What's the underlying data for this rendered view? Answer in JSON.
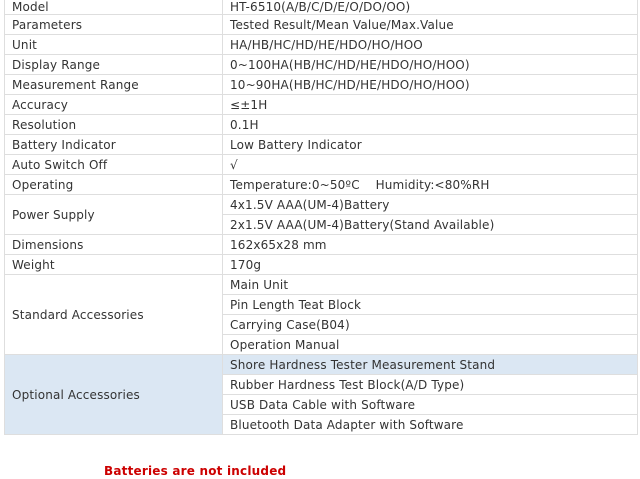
{
  "specs": {
    "model": {
      "label": "Model",
      "value": "HT-6510(A/B/C/D/E/O/DO/OO)"
    },
    "parameters": {
      "label": "Parameters",
      "value": "Tested Result/Mean Value/Max.Value"
    },
    "unit": {
      "label": "Unit",
      "value": "HA/HB/HC/HD/HE/HDO/HO/HOO"
    },
    "display_range": {
      "label": "Display Range",
      "value": "0~100HA(HB/HC/HD/HE/HDO/HO/HOO)"
    },
    "measurement_range": {
      "label": "Measurement Range",
      "value": "10~90HA(HB/HC/HD/HE/HDO/HO/HOO)"
    },
    "accuracy": {
      "label": "Accuracy",
      "value": "≤±1H"
    },
    "resolution": {
      "label": "Resolution",
      "value": "0.1H"
    },
    "battery_indicator": {
      "label": "Battery Indicator",
      "value": "Low Battery Indicator"
    },
    "auto_switch_off": {
      "label": "Auto Switch Off",
      "value": "√"
    },
    "operating": {
      "label": "Operating",
      "value": "Temperature:0~50ºC    Humidity:<80%RH"
    },
    "power_supply": {
      "label": "Power Supply",
      "values": [
        "4x1.5V AAA(UM-4)Battery",
        "2x1.5V AAA(UM-4)Battery(Stand Available)"
      ]
    },
    "dimensions": {
      "label": "Dimensions",
      "value": "162x65x28 mm"
    },
    "weight": {
      "label": "Weight",
      "value": "170g"
    },
    "standard_accessories": {
      "label": "Standard Accessories",
      "values": [
        "Main Unit",
        "Pin Length Teat Block",
        "Carrying Case(B04)",
        "Operation Manual"
      ]
    },
    "optional_accessories": {
      "label": "Optional Accessories",
      "values": [
        "Shore Hardness Tester Measurement Stand",
        "Rubber Hardness Test Block(A/D Type)",
        "USB Data Cable with Software",
        "Bluetooth Data Adapter with Software"
      ]
    }
  },
  "note": "Batteries are not included",
  "colors": {
    "highlight": "#dbe7f3",
    "note": "#cc0000",
    "border": "#dedede"
  }
}
